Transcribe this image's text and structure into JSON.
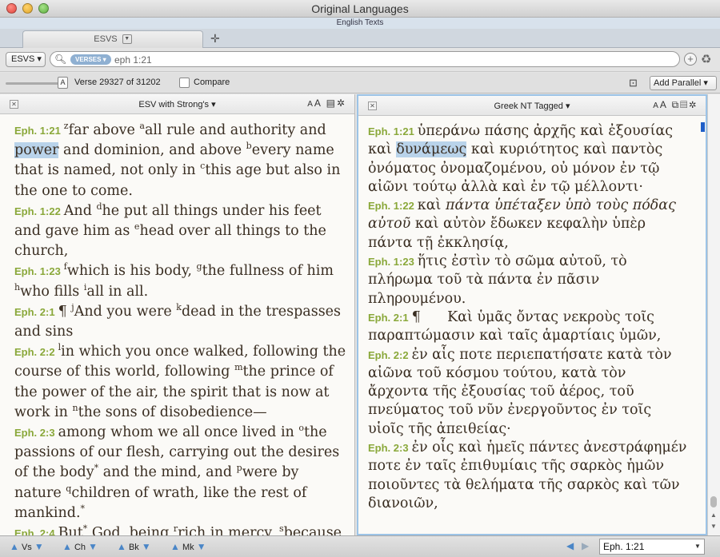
{
  "window": {
    "title": "Original Languages",
    "subtitle": "English Texts"
  },
  "tabs": [
    {
      "label": "ESVS"
    }
  ],
  "search": {
    "resource_button": "ESVS ▾",
    "scope_pill": "VERSES ▾",
    "value": "eph 1:21"
  },
  "verse_bar": {
    "slider_glyph": "A",
    "verse_count": "Verse 29327 of 31202",
    "compare_label": "Compare",
    "add_parallel": "Add Parallel ▾"
  },
  "left_pane": {
    "title": "ESV with Strong's ▾",
    "verses": [
      {
        "ref": "Eph. 1:21"
      },
      {
        "ref": "Eph. 1:22"
      },
      {
        "ref": "Eph. 1:23"
      },
      {
        "ref": "Eph. 2:1"
      },
      {
        "ref": "Eph. 2:2"
      },
      {
        "ref": "Eph. 2:3"
      },
      {
        "ref": "Eph. 2:4"
      }
    ]
  },
  "right_pane": {
    "title": "Greek NT Tagged ▾",
    "verses": [
      {
        "ref": "Eph. 1:21"
      },
      {
        "ref": "Eph. 1:22"
      },
      {
        "ref": "Eph. 1:23"
      },
      {
        "ref": "Eph. 2:1"
      },
      {
        "ref": "Eph. 2:2"
      },
      {
        "ref": "Eph. 2:3"
      }
    ]
  },
  "bottom": {
    "nav": [
      {
        "label": "Vs"
      },
      {
        "label": "Ch"
      },
      {
        "label": "Bk"
      },
      {
        "label": "Mk"
      }
    ],
    "reference": "Eph. 1:21"
  },
  "colors": {
    "verse_ref": "#8aa83a",
    "highlight": "#b9d3ea",
    "active_pane_border": "#9cc3e6",
    "nav_arrow": "#4a86c7"
  }
}
